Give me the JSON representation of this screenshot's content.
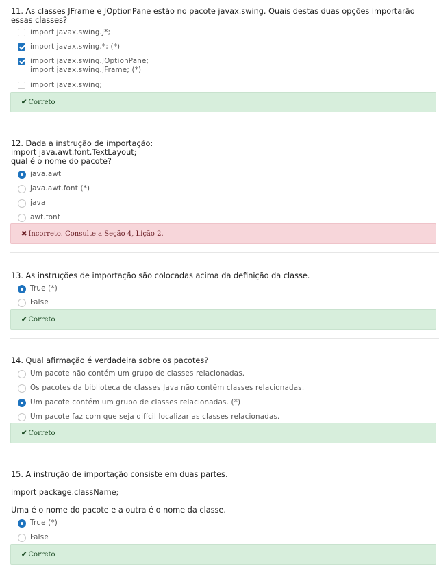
{
  "questions": [
    {
      "text": "11. As classes JFrame e JOptionPane estão no pacote javax.swing. Quais destas duas opções importarão\nessas classes?",
      "options": [
        {
          "label": "import javax.swing.J*;",
          "checked": false
        },
        {
          "label": "import javax.swing.*; (*)",
          "checked": true
        },
        {
          "label": "import javax.swing.JOptionPane;\nimport javax.swing.JFrame; (*)",
          "checked": true
        },
        {
          "label": "import javax.swing;",
          "checked": false
        }
      ],
      "feedback": {
        "icon": "✔",
        "text": "Correto",
        "status": "correct"
      }
    },
    {
      "text": "12. Dada a instrução de importação:\nimport java.awt.font.TextLayout;\nqual é o nome do pacote?",
      "options": [
        {
          "label": "java.awt",
          "checked": true
        },
        {
          "label": "java.awt.font (*)",
          "checked": false
        },
        {
          "label": "java",
          "checked": false
        },
        {
          "label": "awt.font",
          "checked": false
        }
      ],
      "feedback": {
        "icon": "✖",
        "text": "Incorreto. Consulte a Seção 4, Lição 2.",
        "status": "incorrect"
      }
    },
    {
      "text": "13. As instruções de importação são colocadas acima da definição da classe.",
      "options": [
        {
          "label": "True (*)",
          "checked": true
        },
        {
          "label": "False",
          "checked": false
        }
      ],
      "feedback": {
        "icon": "✔",
        "text": "Correto",
        "status": "correct"
      }
    },
    {
      "text": "14. Qual afirmação é verdadeira sobre os pacotes?",
      "options": [
        {
          "label": "Um pacote não contém um grupo de classes relacionadas.",
          "checked": false
        },
        {
          "label": "Os pacotes da biblioteca de classes Java não contêm classes relacionadas.",
          "checked": false
        },
        {
          "label": "Um pacote contém um grupo de classes relacionadas. (*)",
          "checked": true
        },
        {
          "label": "Um pacote faz com que seja difícil localizar as classes relacionadas.",
          "checked": false
        }
      ],
      "feedback": {
        "icon": "✔",
        "text": "Correto",
        "status": "correct"
      }
    },
    {
      "text": "15. A instrução de importação consiste em duas partes.",
      "text2": "import package.className;",
      "text3": "Uma é o nome do pacote e a outra é o nome da classe.",
      "options": [
        {
          "label": "True (*)",
          "checked": true
        },
        {
          "label": "False",
          "checked": false
        }
      ],
      "feedback": {
        "icon": "✔",
        "text": "Correto",
        "status": "correct"
      }
    }
  ]
}
